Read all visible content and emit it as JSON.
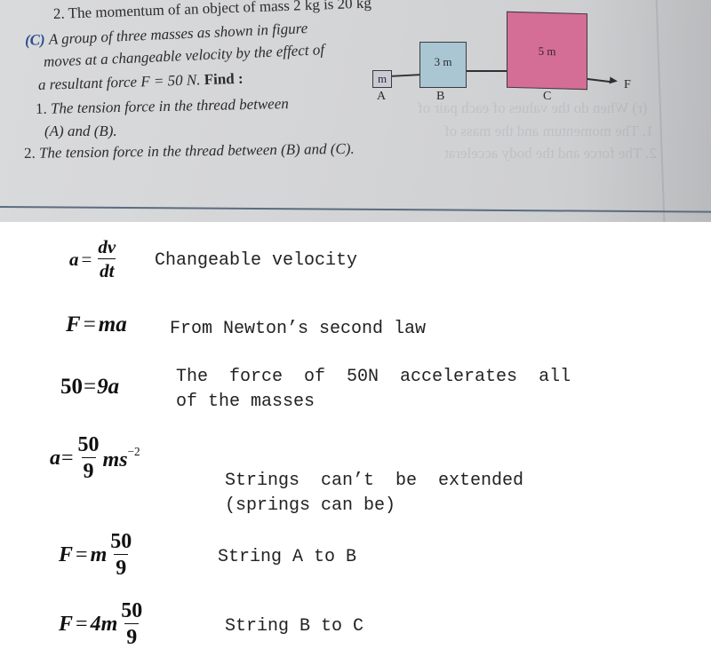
{
  "textbook_photo": {
    "prev_item": "2. The momentum of an object of mass 2 kg is 20 kg",
    "question_label": "(C)",
    "question_lines": [
      "A group of three masses as shown in figure",
      "moves at a changeable velocity by the effect of",
      "a resultant force F = 50 N."
    ],
    "find_label": "Find :",
    "sub_items": [
      {
        "number": "1.",
        "text_line1": "The tension force in the thread between",
        "text_line2": "(A) and (B)."
      },
      {
        "number": "2.",
        "text_line1": "The tension force in the thread between (B) and (C)."
      }
    ],
    "bleed_through": [
      "(r) When do the values of each pair of",
      "1. The momentum and the mass of",
      "2. The force and the body accelerat"
    ],
    "diagram": {
      "masses": [
        {
          "label": "A",
          "mass": "m",
          "color": "#cbc9d3"
        },
        {
          "label": "B",
          "mass": "3 m",
          "color": "#a9c6d2"
        },
        {
          "label": "C",
          "mass": "5 m",
          "color": "#d46e96"
        }
      ],
      "force_label": "F"
    }
  },
  "solution": {
    "steps": [
      {
        "lhs": "a",
        "rhs_num": "dv",
        "rhs_den": "dt",
        "note": "Changeable velocity"
      },
      {
        "equation": "F = ma",
        "lhs": "F",
        "rhs": "ma",
        "note": "From Newton’s second law"
      },
      {
        "lhs": "50",
        "rhs": "9a",
        "note": "The  force  of  50N  accelerates  all\nof the masses"
      },
      {
        "lhs": "a",
        "rhs_num": "50",
        "rhs_den": "9",
        "unit": "ms",
        "unit_exp": "−2",
        "note": "Strings  can’t  be  extended\n(springs can be)"
      },
      {
        "lhs": "F",
        "coef": "m",
        "rhs_num": "50",
        "rhs_den": "9",
        "note": "String A to B"
      },
      {
        "lhs": "F",
        "coef": "4m",
        "rhs_num": "50",
        "rhs_den": "9",
        "note": "String B to C"
      }
    ]
  }
}
